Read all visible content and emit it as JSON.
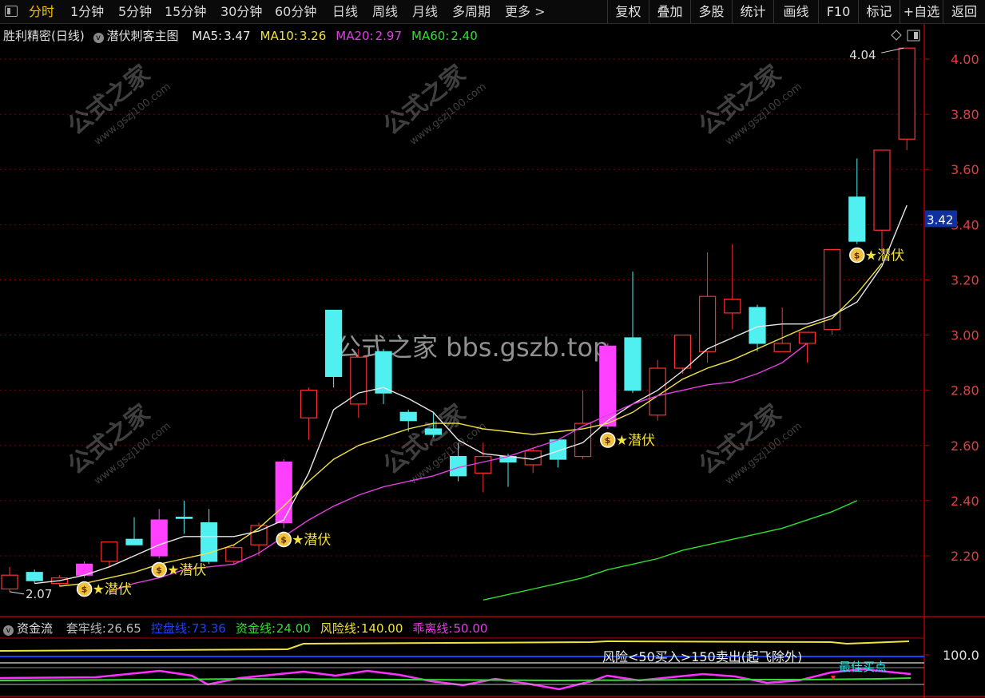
{
  "toolbar": {
    "periods": [
      "分时",
      "1分钟",
      "5分钟",
      "15分钟",
      "30分钟",
      "60分钟",
      "日线",
      "周线",
      "月线",
      "多周期",
      "更多"
    ],
    "actions": [
      "复权",
      "叠加",
      "多股",
      "统计",
      "画线",
      "F10",
      "标记",
      "+自选",
      "返回"
    ]
  },
  "main": {
    "title": "胜利精密(日线)",
    "indicator": "潜伏刺客主图",
    "ma": [
      {
        "label": "MA5:",
        "value": "3.47",
        "color": "#e8e8e8"
      },
      {
        "label": "MA10:",
        "value": "3.26",
        "color": "#f0e040"
      },
      {
        "label": "MA20:",
        "value": "2.97",
        "color": "#e040e0"
      },
      {
        "label": "MA60:",
        "value": "2.40",
        "color": "#30e030"
      }
    ],
    "watermark": "公式之家 bbs.gszb.top",
    "watermark_small": "公式之家",
    "watermark_url": "www.gszj100.com"
  },
  "sub": {
    "title": "资金流",
    "indicators": [
      {
        "label": "套牢线:",
        "value": "26.65",
        "color": "#bbbbbb"
      },
      {
        "label": "控盘线:",
        "value": "73.36",
        "color": "#2040ff"
      },
      {
        "label": "资金线:",
        "value": "24.00",
        "color": "#30e030"
      },
      {
        "label": "风险线:",
        "value": "140.00",
        "color": "#f0e040"
      },
      {
        "label": "乖离线:",
        "value": "50.00",
        "color": "#e040e0"
      }
    ],
    "note": "风险<50买入>150卖出(起飞除外)",
    "note2": "最佳买点",
    "axis_label": "100.0"
  },
  "chart_data": {
    "type": "candlestick",
    "y_axis": {
      "min": 2.0,
      "max": 4.1,
      "ticks": [
        "2.20",
        "2.40",
        "2.60",
        "2.80",
        "3.00",
        "3.20",
        "3.40",
        "3.60",
        "3.80",
        "4.00"
      ]
    },
    "last_price": "3.42",
    "high_label": "4.04",
    "low_label": "2.07",
    "candles": [
      {
        "o": 2.08,
        "c": 2.13,
        "h": 2.16,
        "l": 2.07,
        "col": "red"
      },
      {
        "o": 2.14,
        "c": 2.11,
        "h": 2.15,
        "l": 2.1,
        "col": "cyan"
      },
      {
        "o": 2.1,
        "c": 2.12,
        "h": 2.13,
        "l": 2.09,
        "col": "red"
      },
      {
        "o": 2.13,
        "c": 2.17,
        "h": 2.18,
        "l": 2.12,
        "col": "magenta"
      },
      {
        "o": 2.18,
        "c": 2.25,
        "h": 2.25,
        "l": 2.16,
        "col": "red"
      },
      {
        "o": 2.26,
        "c": 2.24,
        "h": 2.34,
        "l": 2.24,
        "col": "cyan"
      },
      {
        "o": 2.2,
        "c": 2.33,
        "h": 2.37,
        "l": 2.19,
        "col": "magenta"
      },
      {
        "o": 2.34,
        "c": 2.34,
        "h": 2.4,
        "l": 2.28,
        "col": "cyan"
      },
      {
        "o": 2.32,
        "c": 2.18,
        "h": 2.37,
        "l": 2.17,
        "col": "cyan"
      },
      {
        "o": 2.18,
        "c": 2.23,
        "h": 2.24,
        "l": 2.17,
        "col": "red"
      },
      {
        "o": 2.24,
        "c": 2.31,
        "h": 2.32,
        "l": 2.2,
        "col": "red"
      },
      {
        "o": 2.32,
        "c": 2.54,
        "h": 2.55,
        "l": 2.3,
        "col": "magenta"
      },
      {
        "o": 2.7,
        "c": 2.8,
        "h": 2.81,
        "l": 2.62,
        "col": "red"
      },
      {
        "o": 3.09,
        "c": 2.85,
        "h": 3.09,
        "l": 2.81,
        "col": "cyan"
      },
      {
        "o": 2.75,
        "c": 2.92,
        "h": 2.95,
        "l": 2.7,
        "col": "red"
      },
      {
        "o": 2.94,
        "c": 2.79,
        "h": 2.95,
        "l": 2.75,
        "col": "cyan"
      },
      {
        "o": 2.72,
        "c": 2.69,
        "h": 2.73,
        "l": 2.65,
        "col": "cyan"
      },
      {
        "o": 2.66,
        "c": 2.64,
        "h": 2.72,
        "l": 2.63,
        "col": "cyan"
      },
      {
        "o": 2.56,
        "c": 2.49,
        "h": 2.61,
        "l": 2.47,
        "col": "cyan"
      },
      {
        "o": 2.5,
        "c": 2.56,
        "h": 2.61,
        "l": 2.43,
        "col": "red"
      },
      {
        "o": 2.56,
        "c": 2.54,
        "h": 2.57,
        "l": 2.45,
        "col": "cyan"
      },
      {
        "o": 2.53,
        "c": 2.58,
        "h": 2.59,
        "l": 2.5,
        "col": "red"
      },
      {
        "o": 2.62,
        "c": 2.55,
        "h": 2.62,
        "l": 2.52,
        "col": "cyan"
      },
      {
        "o": 2.56,
        "c": 2.68,
        "h": 2.8,
        "l": 2.55,
        "col": "red"
      },
      {
        "o": 2.67,
        "c": 2.96,
        "h": 2.97,
        "l": 2.66,
        "col": "magenta"
      },
      {
        "o": 2.99,
        "c": 2.8,
        "h": 3.23,
        "l": 2.79,
        "col": "cyan"
      },
      {
        "o": 2.71,
        "c": 2.88,
        "h": 2.91,
        "l": 2.69,
        "col": "red"
      },
      {
        "o": 2.88,
        "c": 3.0,
        "h": 3.0,
        "l": 2.86,
        "col": "red"
      },
      {
        "o": 2.94,
        "c": 3.14,
        "h": 3.3,
        "l": 2.9,
        "col": "red"
      },
      {
        "o": 3.08,
        "c": 3.13,
        "h": 3.33,
        "l": 3.02,
        "col": "red"
      },
      {
        "o": 3.1,
        "c": 2.97,
        "h": 3.11,
        "l": 2.94,
        "col": "cyan"
      },
      {
        "o": 2.94,
        "c": 2.97,
        "h": 3.1,
        "l": 2.94,
        "col": "red"
      },
      {
        "o": 2.97,
        "c": 3.01,
        "h": 3.01,
        "l": 2.9,
        "col": "red"
      },
      {
        "o": 3.02,
        "c": 3.31,
        "h": 3.31,
        "l": 3.0,
        "col": "red"
      },
      {
        "o": 3.5,
        "c": 3.34,
        "h": 3.64,
        "l": 3.33,
        "col": "cyan"
      },
      {
        "o": 3.38,
        "c": 3.67,
        "h": 3.67,
        "l": 3.3,
        "col": "red"
      },
      {
        "o": 3.71,
        "c": 4.04,
        "h": 4.04,
        "l": 3.67,
        "col": "red"
      }
    ],
    "ma_series": [
      {
        "name": "MA5",
        "color": "#e8e8e8",
        "start": 1,
        "values": [
          2.1,
          2.11,
          2.13,
          2.16,
          2.2,
          2.24,
          2.27,
          2.27,
          2.27,
          2.29,
          2.33,
          2.5,
          2.73,
          2.79,
          2.81,
          2.77,
          2.72,
          2.62,
          2.57,
          2.56,
          2.55,
          2.58,
          2.61,
          2.69,
          2.75,
          2.8,
          2.87,
          2.95,
          2.99,
          3.03,
          3.04,
          3.04,
          3.07,
          3.12,
          3.25,
          3.47
        ]
      },
      {
        "name": "MA10",
        "color": "#f0e040",
        "start": 2,
        "values": [
          2.09,
          2.1,
          2.12,
          2.14,
          2.17,
          2.19,
          2.21,
          2.24,
          2.3,
          2.38,
          2.47,
          2.55,
          2.6,
          2.63,
          2.66,
          2.68,
          2.68,
          2.66,
          2.65,
          2.64,
          2.65,
          2.66,
          2.68,
          2.72,
          2.78,
          2.84,
          2.88,
          2.91,
          2.95,
          2.99,
          3.03,
          3.06,
          3.15,
          3.26
        ]
      },
      {
        "name": "MA20",
        "color": "#e040e0",
        "start": 4,
        "values": [
          2.07,
          2.1,
          2.12,
          2.15,
          2.16,
          2.17,
          2.21,
          2.27,
          2.33,
          2.38,
          2.42,
          2.45,
          2.47,
          2.49,
          2.52,
          2.54,
          2.56,
          2.59,
          2.62,
          2.67,
          2.71,
          2.75,
          2.78,
          2.8,
          2.82,
          2.83,
          2.86,
          2.9,
          2.97
        ]
      },
      {
        "name": "MA60",
        "color": "#30e030",
        "start": 19,
        "values": [
          2.04,
          2.06,
          2.08,
          2.1,
          2.12,
          2.15,
          2.17,
          2.19,
          2.22,
          2.24,
          2.26,
          2.28,
          2.3,
          2.33,
          2.36,
          2.4
        ]
      }
    ],
    "signals": [
      {
        "index": 3,
        "label": "★潜伏"
      },
      {
        "index": 6,
        "label": "★潜伏"
      },
      {
        "index": 11,
        "label": "★潜伏"
      },
      {
        "index": 24,
        "label": "★潜伏"
      },
      {
        "index": 34,
        "label": "★潜伏"
      }
    ]
  }
}
